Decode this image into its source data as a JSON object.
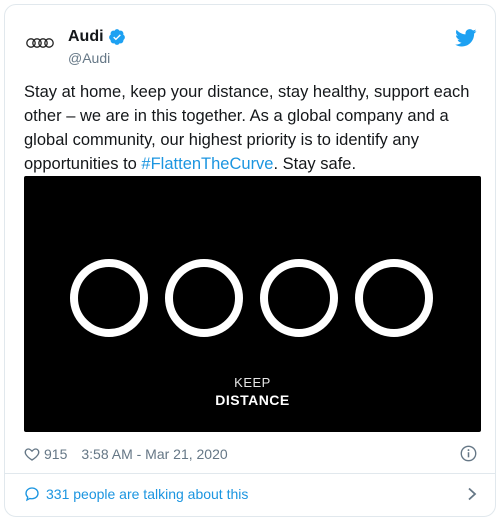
{
  "account": {
    "name": "Audi",
    "handle": "@Audi",
    "avatar_icon": "audi-rings-logo",
    "verified_icon": "verified-badge-icon",
    "brand_color": "#1da1f2"
  },
  "tweet": {
    "text_before": "Stay at home, keep your distance, stay healthy, support each other – we are in this together. As a global company and a global community, our highest priority is to identify any opportunities to ",
    "hashtag": "#FlattenTheCurve",
    "text_after": ". Stay safe."
  },
  "media": {
    "line1": "KEEP",
    "line2": "DISTANCE",
    "background": "#000000"
  },
  "meta": {
    "likes": "915",
    "timestamp": "3:58 AM - Mar 21, 2020"
  },
  "footer": {
    "conversation": "331 people are talking about this"
  },
  "colors": {
    "link": "#1b95e0",
    "secondary_text": "#657786",
    "border": "#e1e8ed"
  }
}
